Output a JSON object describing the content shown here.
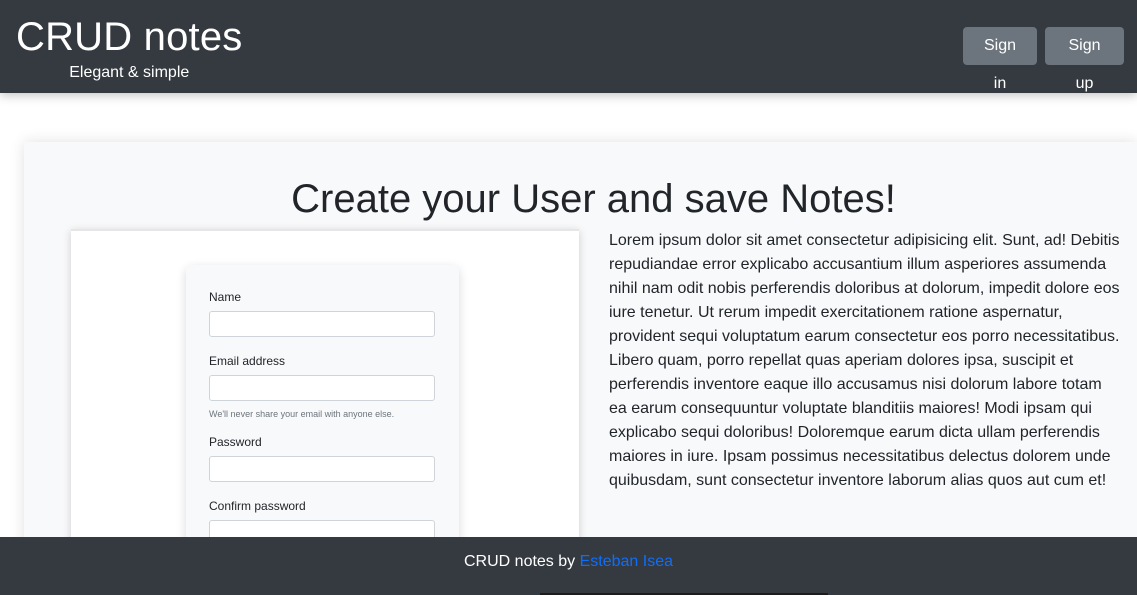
{
  "header": {
    "brand_title": "CRUD notes",
    "brand_subtitle": "Elegant & simple",
    "signin_label": "Sign in",
    "signup_label": "Sign up"
  },
  "hero": {
    "title": "Create your User and save Notes!",
    "paragraph": "Lorem ipsum dolor sit amet consectetur adipisicing elit. Sunt, ad! Debitis repudiandae error explicabo accusantium illum asperiores assumenda nihil nam odit nobis perferendis doloribus at dolorum, impedit dolore eos iure tenetur. Ut rerum impedit exercitationem ratione aspernatur, provident sequi voluptatum earum consectetur eos porro necessitatibus. Libero quam, porro repellat quas aperiam dolores ipsa, suscipit et perferendis inventore eaque illo accusamus nisi dolorum labore totam ea earum consequuntur voluptate blanditiis maiores! Modi ipsam qui explicabo sequi doloribus! Doloremque earum dicta ullam perferendis maiores in iure. Ipsam possimus necessitatibus delectus dolorem unde quibusdam, sunt consectetur inventore laborum alias quos aut cum et!"
  },
  "preview_form": {
    "name_label": "Name",
    "email_label": "Email address",
    "email_help": "We'll never share your email with anyone else.",
    "password_label": "Password",
    "confirm_label": "Confirm password"
  },
  "footer": {
    "text": "CRUD notes by ",
    "author_link": "Esteban Isea",
    "link_color": "#0d6efd"
  },
  "colors": {
    "navbar_bg": "#343a40",
    "button_bg": "#6c757d",
    "jumbotron_bg": "#f8f9fa"
  }
}
